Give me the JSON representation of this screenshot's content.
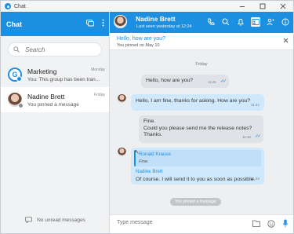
{
  "window": {
    "title": "Chat"
  },
  "sidebar": {
    "header_title": "Chat",
    "search_placeholder": "Search",
    "chats": [
      {
        "name": "Marketing",
        "day": "Monday",
        "preview": "You: This group has been tran..."
      },
      {
        "name": "Nadine Brett",
        "day": "Friday",
        "preview": "You pinned a message"
      }
    ],
    "unread_label": "No unread messages"
  },
  "conversation": {
    "name": "Nadine Brett",
    "status": "Last seen yesterday at 12:24",
    "pinned": {
      "text": "Hello, how are you?",
      "sub": "You pinned on May 10"
    },
    "day_separator": "Friday",
    "messages": [
      {
        "text": "Hello, how are you?",
        "time": "11:41"
      },
      {
        "text": "Hello, I am fine, thanks for asking. How are you?",
        "time": "11:41"
      },
      {
        "lines": [
          "Fine.",
          "Could you please send me the release notes?",
          "Thanks."
        ],
        "time": "11:42"
      },
      {
        "quote_sender": "Ronald Krause",
        "quote_text": "Fine.",
        "sender": "Nadine Brett",
        "text": "Of course. I will send it to you as soon as possible.",
        "time": "11:42"
      }
    ],
    "system_message": "You pinned a message",
    "composer_placeholder": "Type message"
  },
  "colors": {
    "accent": "#1d8fe1",
    "incoming_bubble": "#cfe8fb",
    "outgoing_bubble": "#dfe2e6"
  }
}
